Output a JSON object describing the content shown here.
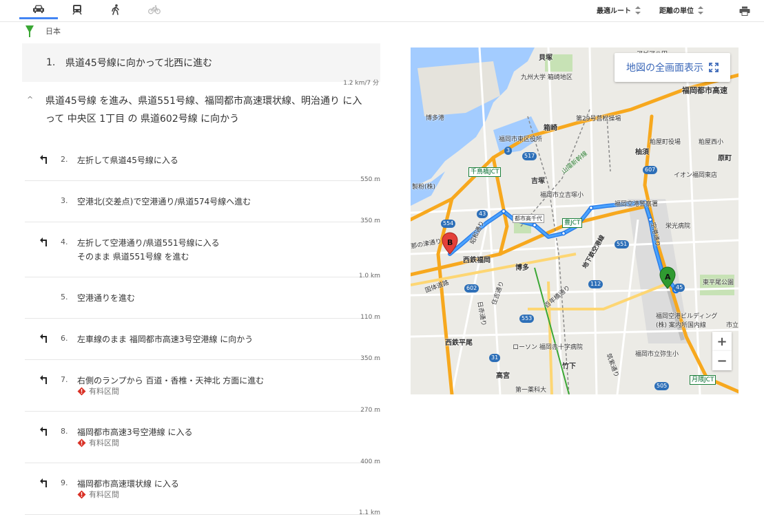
{
  "topbar": {
    "modes": [
      {
        "icon": "car-icon",
        "active": true
      },
      {
        "icon": "train-icon",
        "active": false
      },
      {
        "icon": "walk-icon",
        "active": false
      },
      {
        "icon": "bicycle-icon",
        "active": false
      }
    ],
    "route_option": "最適ルート",
    "unit_option": "距離の単位"
  },
  "start": {
    "label": "日本"
  },
  "step1": {
    "num": "1.",
    "text": "県道45号線に向かって北西に進む",
    "distance": "1.2 km/7 分"
  },
  "section": {
    "text": "県道45号線 を進み、県道551号線、福岡都市高速環状線、明治通り に入って 中央区 1丁目 の 県道602号線 に向かう"
  },
  "steps": [
    {
      "num": "2.",
      "lines": [
        "左折して県道45号線に入る"
      ],
      "toll": "",
      "distance": "550 m",
      "has_icon": true
    },
    {
      "num": "3.",
      "lines": [
        "空港北(交差点)で空港通り/県道574号線へ進む"
      ],
      "toll": "",
      "distance": "350 m",
      "has_icon": false
    },
    {
      "num": "4.",
      "lines": [
        "左折して空港通り/県道551号線に入る",
        "そのまま 県道551号線 を進む"
      ],
      "toll": "",
      "distance": "1.0 km",
      "has_icon": true
    },
    {
      "num": "5.",
      "lines": [
        "空港通りを進む"
      ],
      "toll": "",
      "distance": "110 m",
      "has_icon": false
    },
    {
      "num": "6.",
      "lines": [
        "左車線のまま 福岡都市高速3号空港線 に向かう"
      ],
      "toll": "",
      "distance": "350 m",
      "has_icon": true
    },
    {
      "num": "7.",
      "lines": [
        "右側のランプから 百道・香椎・天神北 方面に進む"
      ],
      "toll": "有料区間",
      "distance": "270 m",
      "has_icon": true
    },
    {
      "num": "8.",
      "lines": [
        "福岡都市高速3号空港線 に入る"
      ],
      "toll": "有料区間",
      "distance": "400 m",
      "has_icon": true
    },
    {
      "num": "9.",
      "lines": [
        "福岡都市高速環状線 に入る"
      ],
      "toll": "有料区間",
      "distance": "1.1 km",
      "has_icon": true
    }
  ],
  "map": {
    "fullscreen_label": "地図の全画面表示",
    "zoom_in": "+",
    "zoom_out": "−",
    "marker_a": "A",
    "marker_b": "B",
    "labels": [
      {
        "text": "貝塚",
        "big": true
      },
      {
        "text": "九州大学 箱崎地区",
        "big": false
      },
      {
        "text": "アピア八田",
        "big": false
      },
      {
        "text": "福岡都市高速",
        "big": false
      },
      {
        "text": "博多港",
        "big": false
      },
      {
        "text": "箱崎",
        "big": true
      },
      {
        "text": "第29号莒松操場",
        "big": false
      },
      {
        "text": "福岡市東区役所",
        "big": false
      },
      {
        "text": "粕屋町役場",
        "big": false
      },
      {
        "text": "粕屋西小",
        "big": false
      },
      {
        "text": "柚須",
        "big": true
      },
      {
        "text": "原町",
        "big": true
      },
      {
        "text": "吉塚",
        "big": true
      },
      {
        "text": "イオン福岡東店",
        "big": false
      },
      {
        "text": "福岡市立吉塚小",
        "big": false
      },
      {
        "text": "山陽新幹線",
        "big": false
      },
      {
        "text": "製粉(株)",
        "big": false
      },
      {
        "text": "福岡空港警察署",
        "big": false
      },
      {
        "text": "栄光病院",
        "big": false
      },
      {
        "text": "都市高千代",
        "big": false
      },
      {
        "text": "昭和通り",
        "big": false
      },
      {
        "text": "西鉄福岡",
        "big": true
      },
      {
        "text": "博多",
        "big": true
      },
      {
        "text": "地下鉄空港線",
        "big": false
      },
      {
        "text": "空港通り",
        "big": false
      },
      {
        "text": "東平尾公園",
        "big": false
      },
      {
        "text": "国体道路",
        "big": false
      },
      {
        "text": "住吉通り",
        "big": false
      },
      {
        "text": "百年橋通り",
        "big": false
      },
      {
        "text": "福岡空港ビルディング",
        "big": false
      },
      {
        "text": "(株) 案内所国内線",
        "big": false
      },
      {
        "text": "日赤通り",
        "big": false
      },
      {
        "text": "西鉄平尾",
        "big": true
      },
      {
        "text": "ローソン 福岡赤十字病院",
        "big": false
      },
      {
        "text": "福岡市立弥生小",
        "big": false
      },
      {
        "text": "竹下",
        "big": true
      },
      {
        "text": "高宮",
        "big": true
      },
      {
        "text": "第一薬科大",
        "big": false
      },
      {
        "text": "筑紫通り",
        "big": false
      },
      {
        "text": "那の津通り",
        "big": false
      },
      {
        "text": "市立",
        "big": false
      }
    ],
    "jct_labels": [
      "千鳥橋JCT",
      "豊JCT",
      "月隈JCT"
    ],
    "shields": [
      "3",
      "517",
      "607",
      "43",
      "554",
      "551",
      "45",
      "602",
      "112",
      "553",
      "31",
      "505"
    ]
  }
}
